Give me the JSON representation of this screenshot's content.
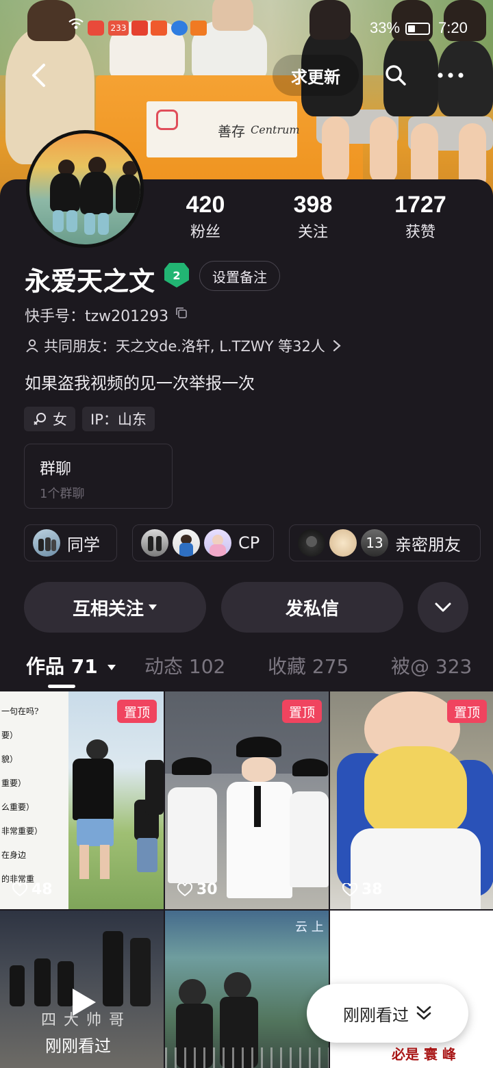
{
  "status_bar": {
    "notif_badge": "233",
    "battery": "33%",
    "time": "7:20"
  },
  "cover": {
    "sign_text_cn": "善存",
    "sign_text_en": "Centrum"
  },
  "top_nav": {
    "update_request": "求更新"
  },
  "profile": {
    "name": "永爱天之文",
    "level": "2",
    "set_remark": "设置备注",
    "kuaishou_id": "快手号：tzw201293",
    "mutual_friends": "共同朋友：天之文de.洛轩, L.TZWY 等32人",
    "bio": "如果盗我视频的见一次举报一次",
    "gender_tag": "女",
    "ip_tag": "IP：山东"
  },
  "stats": [
    {
      "value": "420",
      "label": "粉丝"
    },
    {
      "value": "398",
      "label": "关注"
    },
    {
      "value": "1727",
      "label": "获赞"
    }
  ],
  "group_card": {
    "title": "群聊",
    "subtitle": "1个群聊"
  },
  "relation_chips": [
    {
      "label": "同学"
    },
    {
      "label": "CP"
    },
    {
      "label": "亲密朋友",
      "count": "13"
    }
  ],
  "actions": {
    "follow": "互相关注",
    "message": "发私信"
  },
  "tabs": [
    {
      "label": "作品 71",
      "active": true
    },
    {
      "label": "动态 102",
      "active": false
    },
    {
      "label": "收藏 275",
      "active": false
    },
    {
      "label": "被@ 323",
      "active": false
    }
  ],
  "grid": [
    {
      "pinned": "置顶",
      "likes": "48",
      "note_lines": [
        "一句在吗?",
        "要）",
        "貌）",
        "重要）",
        "么重要）",
        "非常重要）",
        "在身边",
        "的非常重"
      ]
    },
    {
      "pinned": "置顶",
      "likes": "30"
    },
    {
      "pinned": "置顶",
      "likes": "38"
    },
    {
      "overlay_text": "四 大 帅 哥",
      "watched_label": "刚刚看过"
    },
    {
      "banner_text": "云 上"
    },
    {}
  ],
  "floating": {
    "just_watched": "刚刚看过",
    "watermark": "必是 寰 峰"
  },
  "colors": {
    "background": "#1c191f",
    "button_bg": "#302c35",
    "pin_badge": "#f0445f",
    "level_badge": "#22b573"
  }
}
